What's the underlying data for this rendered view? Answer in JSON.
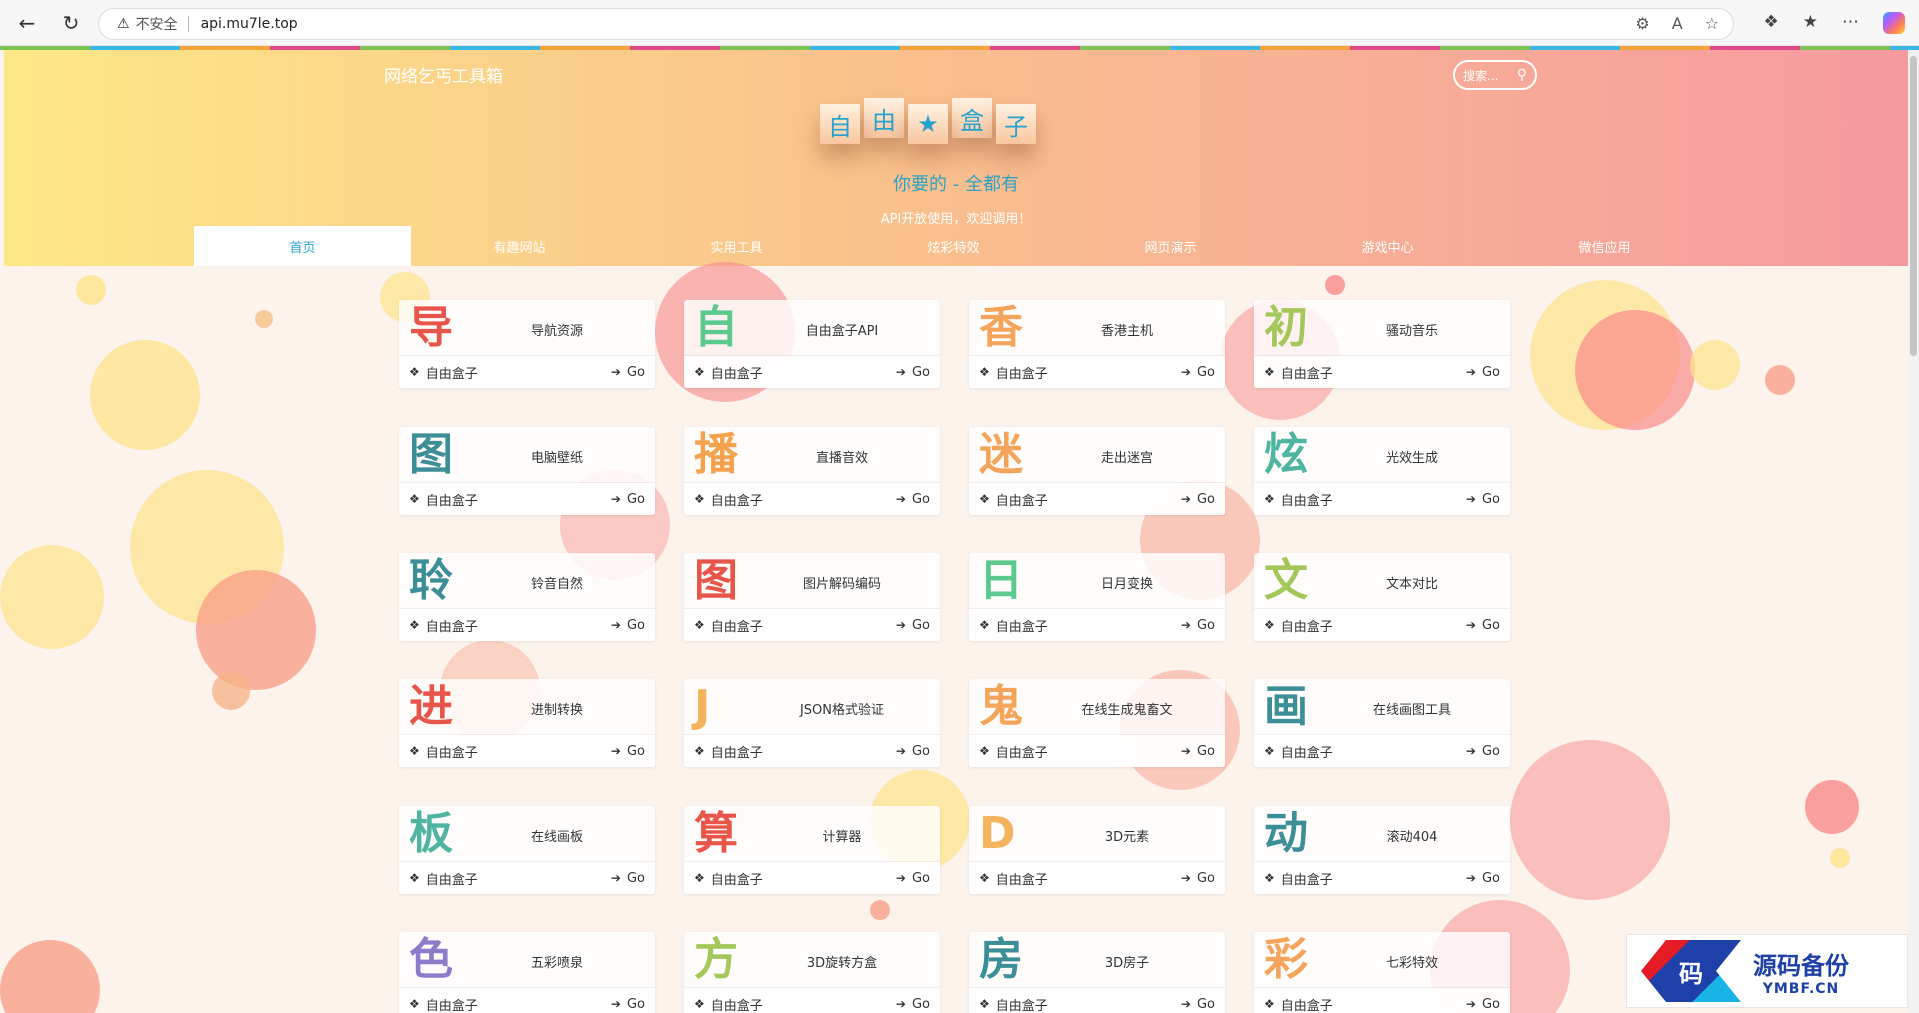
{
  "browser": {
    "security_label": "不安全",
    "url": "api.mu7le.top"
  },
  "header": {
    "site_title": "网络乞丐工具箱",
    "search_placeholder": "搜索...",
    "logo_chars": [
      "自",
      "由",
      "★",
      "盒",
      "子"
    ],
    "slogan": "你要的 - 全都有",
    "sub_slogan": "API开放使用，欢迎调用！"
  },
  "tabs": [
    {
      "label": "首页",
      "active": true
    },
    {
      "label": "有趣网站",
      "active": false
    },
    {
      "label": "实用工具",
      "active": false
    },
    {
      "label": "炫彩特效",
      "active": false
    },
    {
      "label": "网页演示",
      "active": false
    },
    {
      "label": "游戏中心",
      "active": false
    },
    {
      "label": "微信应用",
      "active": false
    }
  ],
  "card_common": {
    "source": "自由盒子",
    "go": "Go"
  },
  "cards": [
    {
      "glyph": "导",
      "title": "导航资源",
      "color": "#e8564b"
    },
    {
      "glyph": "自",
      "title": "自由盒子API",
      "color": "#5cc98f"
    },
    {
      "glyph": "香",
      "title": "香港主机",
      "color": "#f5a45b"
    },
    {
      "glyph": "初",
      "title": "骚动音乐",
      "color": "#a4c75a"
    },
    {
      "glyph": "图",
      "title": "电脑壁纸",
      "color": "#3d8f97"
    },
    {
      "glyph": "播",
      "title": "直播音效",
      "color": "#f4a24e"
    },
    {
      "glyph": "迷",
      "title": "走出迷宫",
      "color": "#f5a45b"
    },
    {
      "glyph": "炫",
      "title": "光效生成",
      "color": "#4fb5a0"
    },
    {
      "glyph": "聆",
      "title": "铃音自然",
      "color": "#3d8f97"
    },
    {
      "glyph": "图",
      "title": "图片解码编码",
      "color": "#e8564b"
    },
    {
      "glyph": "日",
      "title": "日月变换",
      "color": "#5cc98f"
    },
    {
      "glyph": "文",
      "title": "文本对比",
      "color": "#a4c75a"
    },
    {
      "glyph": "进",
      "title": "进制转换",
      "color": "#e8564b"
    },
    {
      "glyph": "J",
      "title": "JSON格式验证",
      "color": "#f5b35b"
    },
    {
      "glyph": "鬼",
      "title": "在线生成鬼畜文",
      "color": "#f5a45b"
    },
    {
      "glyph": "画",
      "title": "在线画图工具",
      "color": "#3d8f97"
    },
    {
      "glyph": "板",
      "title": "在线画板",
      "color": "#4fb5a0"
    },
    {
      "glyph": "算",
      "title": "计算器",
      "color": "#e8564b"
    },
    {
      "glyph": "D",
      "title": "3D元素",
      "color": "#f5b35b"
    },
    {
      "glyph": "动",
      "title": "滚动404",
      "color": "#3d8f97"
    },
    {
      "glyph": "色",
      "title": "五彩喷泉",
      "color": "#8b7bc9"
    },
    {
      "glyph": "方",
      "title": "3D旋转方盒",
      "color": "#a4c75a"
    },
    {
      "glyph": "房",
      "title": "3D房子",
      "color": "#3d8f97"
    },
    {
      "glyph": "彩",
      "title": "七彩特效",
      "color": "#f5a45b"
    }
  ],
  "watermark": {
    "mark": "码",
    "name": "源码备份",
    "domain": "YMBF.CN"
  }
}
